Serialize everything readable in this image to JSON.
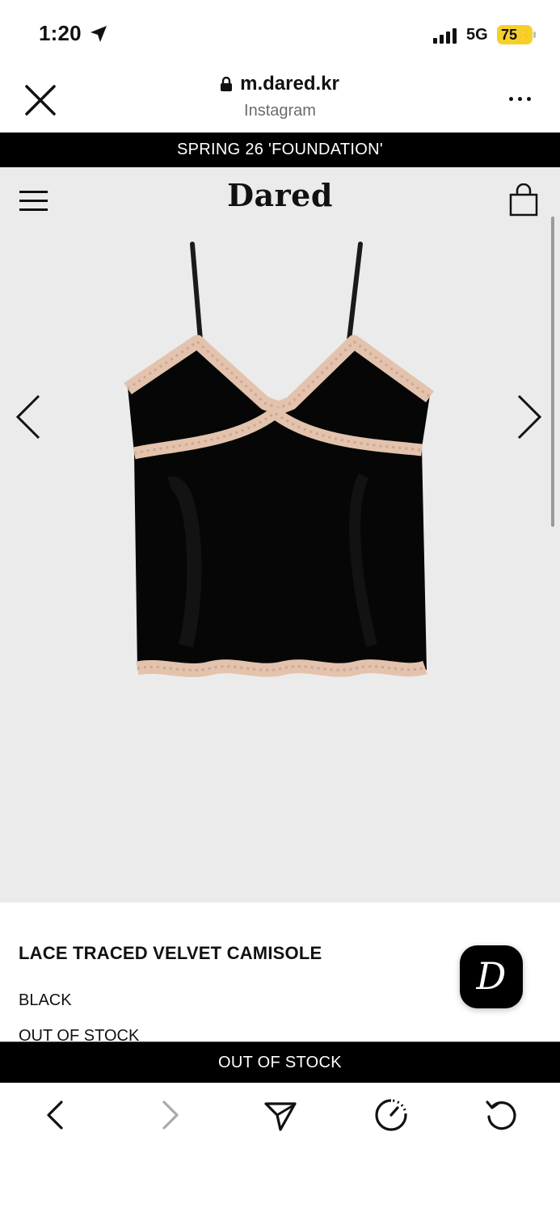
{
  "status_bar": {
    "time": "1:20",
    "network": "5G",
    "battery": "75"
  },
  "browser": {
    "domain": "m.dared.kr",
    "source": "Instagram"
  },
  "announcement": "SPRING 26 'FOUNDATION'",
  "site": {
    "brand": "Dared"
  },
  "product": {
    "name": "LACE TRACED VELVET CAMISOLE",
    "color": "BLACK",
    "stock_status": "OUT OF STOCK",
    "image_alt": "black velvet camisole with beige lace trim"
  },
  "cta": {
    "label": "OUT OF STOCK"
  },
  "chat": {
    "badge_letter": "D"
  },
  "icons": {
    "close": "close-icon",
    "lock": "lock-icon",
    "more": "more-icon",
    "menu": "menu-icon",
    "cart": "shopping-bag-icon",
    "prev": "chevron-left-icon",
    "next": "chevron-right-icon",
    "back": "back-icon",
    "forward": "forward-icon",
    "share": "share-icon",
    "speed": "speed-icon",
    "reload": "reload-icon"
  },
  "colors": {
    "battery": "#f5d02a",
    "gallery_bg": "#ebebeb",
    "banner_bg": "#000000",
    "lace": "#e3c3ad"
  }
}
